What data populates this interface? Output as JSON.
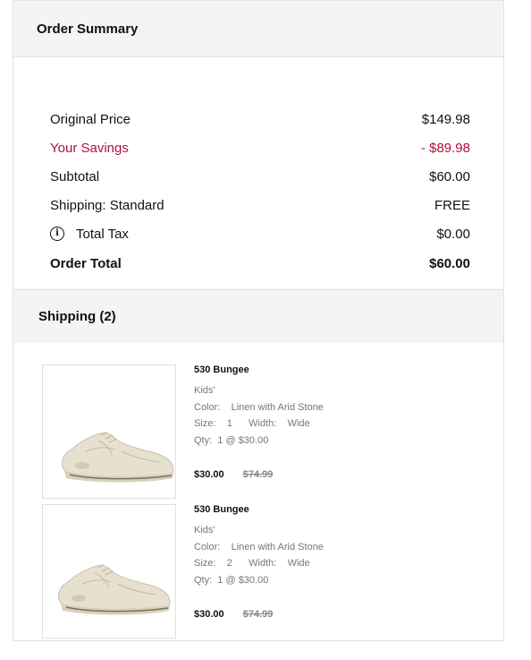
{
  "summary": {
    "title": "Order Summary",
    "rows": [
      {
        "label": "Original Price",
        "value": "$149.98"
      },
      {
        "label": "Your Savings",
        "value": "- $89.98"
      },
      {
        "label": "Subtotal",
        "value": "$60.00"
      },
      {
        "label": "Shipping: Standard",
        "value": "FREE"
      },
      {
        "label": "Total Tax",
        "value": "$0.00",
        "icon": "info-icon"
      },
      {
        "label": "Order Total",
        "value": "$60.00"
      }
    ],
    "savings_color": "#b0103a"
  },
  "shipping": {
    "title": "Shipping (2)",
    "items": [
      {
        "name": "530 Bungee",
        "category": "Kids'",
        "color_label": "Color:",
        "color_value": "Linen with Arid Stone",
        "size_label": "Size:",
        "size_value": "1",
        "width_label": "Width:",
        "width_value": "Wide",
        "qty_label": "Qty:",
        "qty_value": "1 @ $30.00",
        "price": "$30.00",
        "original_price": "$74.99"
      },
      {
        "name": "530 Bungee",
        "category": "Kids'",
        "color_label": "Color:",
        "color_value": "Linen with Arid Stone",
        "size_label": "Size:",
        "size_value": "2",
        "width_label": "Width:",
        "width_value": "Wide",
        "qty_label": "Qty:",
        "qty_value": "1 @ $30.00",
        "price": "$30.00",
        "original_price": "$74.99"
      }
    ]
  }
}
